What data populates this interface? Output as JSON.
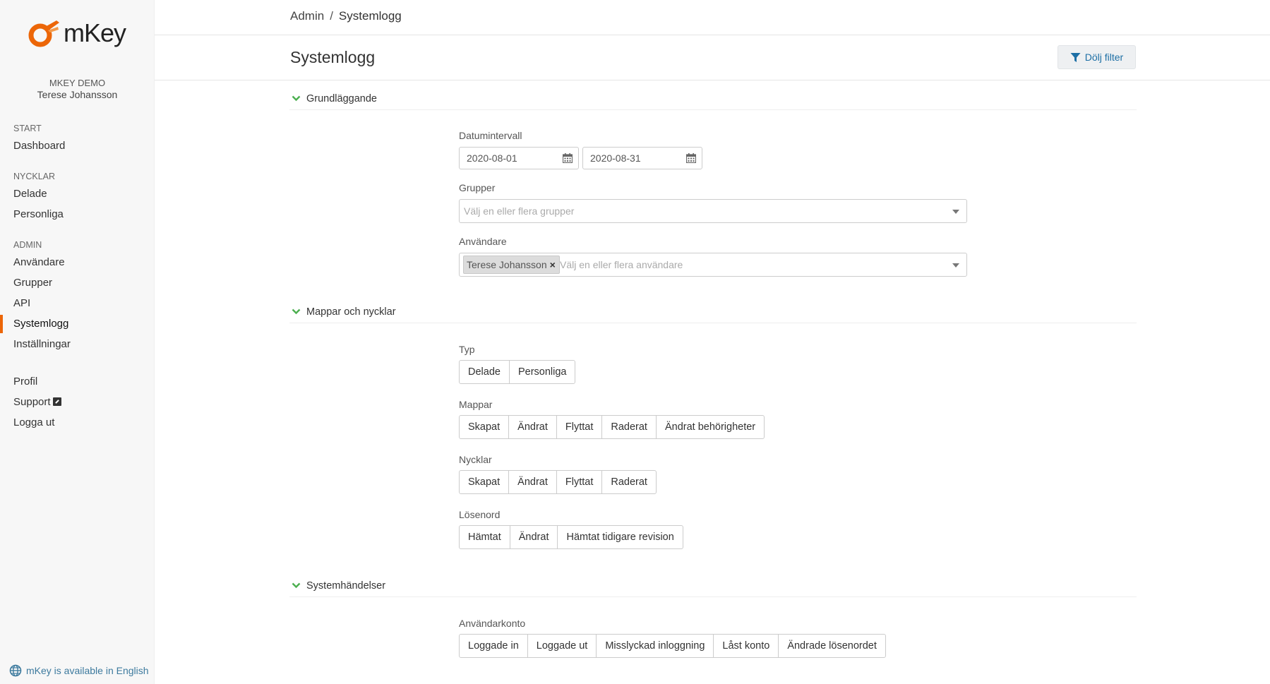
{
  "brand": {
    "logo_text": "mKey",
    "accent": "#ec6608"
  },
  "account": {
    "org": "MKEY DEMO",
    "user": "Terese Johansson"
  },
  "nav": {
    "start_section": "START",
    "dashboard": "Dashboard",
    "keys_section": "NYCKLAR",
    "shared": "Delade",
    "personal": "Personliga",
    "admin_section": "ADMIN",
    "users": "Användare",
    "groups": "Grupper",
    "api": "API",
    "syslog": "Systemlogg",
    "settings": "Inställningar",
    "profile": "Profil",
    "support": "Support",
    "logout": "Logga ut",
    "active": "Systemlogg"
  },
  "language_link": "mKey is available in English",
  "breadcrumb": {
    "root": "Admin",
    "separator": "/",
    "current": "Systemlogg"
  },
  "page_title": "Systemlogg",
  "filter_button": "Dölj filter",
  "sections": {
    "basic": {
      "title": "Grundläggande",
      "date_label": "Datumintervall",
      "date_from": "2020-08-01",
      "date_to": "2020-08-31",
      "groups_label": "Grupper",
      "groups_placeholder": "Välj en eller flera grupper",
      "users_label": "Användare",
      "users_selected": "Terese Johansson",
      "users_placeholder": "Välj en eller flera användare"
    },
    "folders_keys": {
      "title": "Mappar och nycklar",
      "type_label": "Typ",
      "type_options": [
        "Delade",
        "Personliga"
      ],
      "folders_label": "Mappar",
      "folders_options": [
        "Skapat",
        "Ändrat",
        "Flyttat",
        "Raderat",
        "Ändrat behörigheter"
      ],
      "keys_label": "Nycklar",
      "keys_options": [
        "Skapat",
        "Ändrat",
        "Flyttat",
        "Raderat"
      ],
      "password_label": "Lösenord",
      "password_options": [
        "Hämtat",
        "Ändrat",
        "Hämtat tidigare revision"
      ]
    },
    "system": {
      "title": "Systemhändelser",
      "account_label": "Användarkonto",
      "account_options": [
        "Loggade in",
        "Loggade ut",
        "Misslyckad inloggning",
        "Låst konto",
        "Ändrade lösenordet"
      ]
    }
  }
}
